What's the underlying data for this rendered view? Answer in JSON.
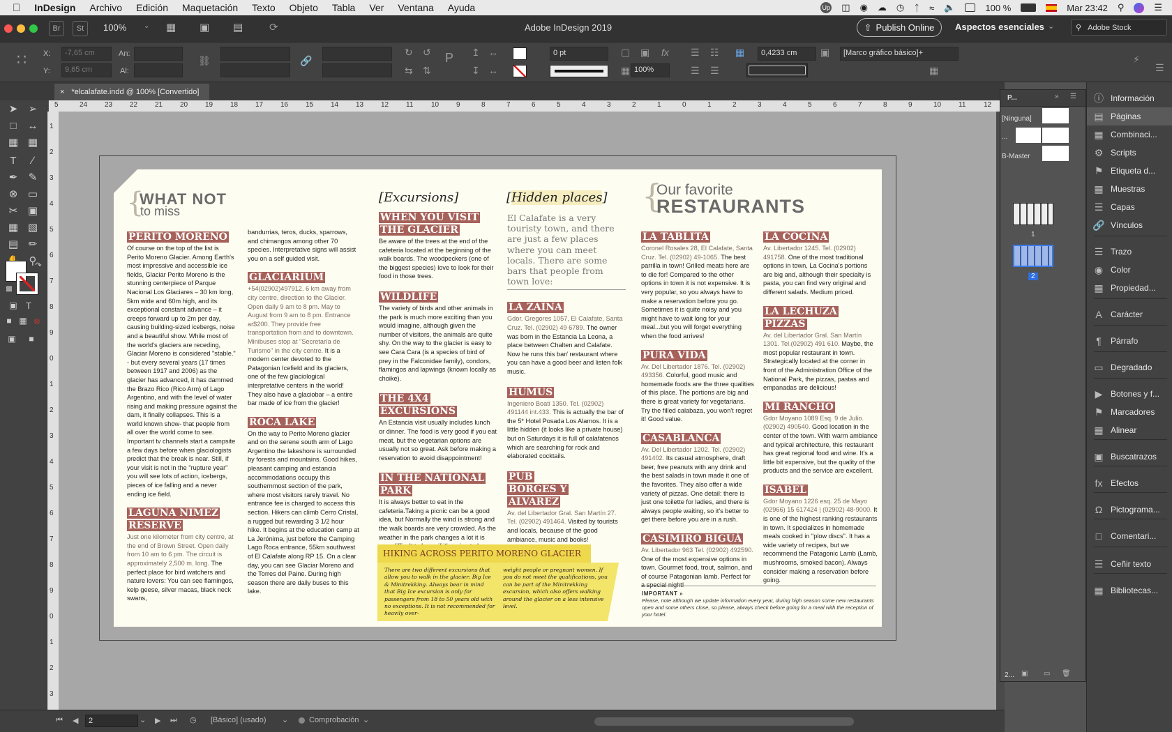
{
  "menubar": {
    "app": "InDesign",
    "items": [
      "Archivo",
      "Edición",
      "Maquetación",
      "Texto",
      "Objeto",
      "Tabla",
      "Ver",
      "Ventana",
      "Ayuda"
    ],
    "battery": "100 %",
    "clock": "Mar 23:42"
  },
  "appbar": {
    "title": "Adobe InDesign 2019",
    "br": "Br",
    "st": "St",
    "zoom": "100%",
    "publish": "Publish Online",
    "workspace": "Aspectos esenciales",
    "stock": "Adobe Stock"
  },
  "control": {
    "x_label": "X:",
    "x_value": "-7,65 cm",
    "y_label": "Y:",
    "y_value": "9,65 cm",
    "an_label": "An:",
    "al_label": "Al:",
    "stroke_weight": "0 pt",
    "scale": "100%",
    "offset": "0,4233 cm",
    "object_style": "[Marco gráfico básico]+"
  },
  "doc_tab": "*elcalafate.indd @ 100% [Convertido]",
  "ruler": {
    "h_ticks": [
      "5",
      "24",
      "23",
      "22",
      "21",
      "20",
      "19",
      "18",
      "17",
      "16",
      "15",
      "14",
      "13",
      "12",
      "11",
      "10",
      "9",
      "8",
      "7",
      "6",
      "5",
      "4",
      "3",
      "2",
      "1",
      "0",
      "1",
      "2",
      "3",
      "4",
      "5",
      "6",
      "7",
      "8",
      "9",
      "10",
      "11",
      "12",
      "13"
    ],
    "v_ticks": [
      "1",
      "2",
      "3",
      "4",
      "5",
      "6",
      "7",
      "8",
      "9",
      "0",
      "1",
      "2",
      "3",
      "4",
      "5",
      "6",
      "7",
      "8",
      "9",
      "0",
      "1",
      "2",
      "3"
    ]
  },
  "page": {
    "what_not_1": "WHAT NOT",
    "what_not_2": "to miss",
    "excursions": "Excursions",
    "hidden": "Hidden places",
    "fav_1": "Our favorite",
    "fav_2": "RESTAURANTS",
    "c1_h1": "PERITO MORENO",
    "c1_t1": "Of course on the top of the list is Perito Moreno Glacier. Among Earth's most impressive and accessible ice fields, Glaciar Perito Moreno is the stunning centerpiece of Parque Nacional Los Glaciares – 30 km long, 5km wide and 60m high, and its exceptional constant advance – it creeps forward up to 2m per day, causing building-sized icebergs, noise and a beautiful show. While most of the world's glaciers are receding, Glaciar Moreno is considered \"stable.\" - but every several years (17 times between 1917 and 2006) as the glacier has advanced, it has dammed the Brazo Rico (Rico Arm) of Lago Argentino, and with the level of water rising and making pressure against the dam, it finally collapses. This is a world known show- that people from all over the world come to see. Important tv channels start a campsite a few days before when glaciologists predict that the break is near. Still, if your visit is not in the \"rupture year\" you will see lots of action, icebergs, pieces of ice falling and a never ending ice field.",
    "c1_h2": "LAGUNA NIMEZ RESERVE",
    "c1_a2": "Just one kilometer from city centre, at the end of Brown Street. Open daily from 10 am to 6 pm. The circuit is approximately 2,500 m. long.",
    "c1_t2": "The perfect place for bird watchers and nature lovers: You can see flamingos, kelp geese, silver macas, black neck swans,",
    "c2_t0": "bandurrias, teros, ducks, sparrows, and chimangos among other 70 species. Interpretative signs will assist you on a self guided visit.",
    "c2_h1": "GLACIARIUM",
    "c2_a1": "+54(02902)497912. 6 km away from city centre, direction to the Glacier. Open daily 9 am to 8 pm. May to August from 9 am to 8 pm. Entrance ar$200. They provide free transportation from and to downtown. Minibuses stop at \"Secretaría de Turismo\" in the city centre.",
    "c2_t1": "It is a modern center devoted to the Patagonian Icefield and its glaciers, one of the few glaciological interpretative centers in the world! They also have a glaciobar – a entire bar made of ice from the glacier!",
    "c2_h2": "ROCA LAKE",
    "c2_t2": "On the way to Perito Moreno glacier and on the serene south arm of Lago Argentino the lakeshore is surrounded by forests and mountains. Good hikes, pleasant camping and estancia accommodations occupy this southernmost section of the park, where most visitors rarely travel. No entrance fee is charged to access this section. Hikers can climb Cerro Cristal, a rugged but rewarding 3 1/2 hour hike. It begins at the education camp at La Jerónima, just before the Camping Lago Roca entrance, 55km southwest of El Calafate along RP 15. On a clear day, you can see Glaciar Moreno and the Torres del Paine. During high season there are daily buses to this lake.",
    "c3_h1": "WHEN YOU VISIT THE GLACIER",
    "c3_t1": "Be aware of the trees at the end of the cafeteria located at the beginning of the walk boards. The woodpeckers (one of the biggest species) love to look for their food in those trees.",
    "c3_h2": "WILDLIFE",
    "c3_t2": "The variety of birds and other animals in the park is much more exciting than you would imagine, although given the number of visitors, the animals are quite shy. On the way to the glacier is easy to see Cara Cara (is a species of bird of prey in the Falconidae family), condors, flamingos and lapwings (known locally as choike).",
    "c3_h3": "THE 4X4 EXCURSIONS",
    "c3_t3": "An Estancia visit usually includes lunch or dinner. The food is very good if you eat meat, but the vegetarian options are usually not so great. Ask before making a reservation to avoid disappointment!",
    "c3_h4": "IN THE NATIONAL PARK",
    "c3_t4": "It is always better to eat in the cafeteria.Taking a picnic can be a good idea, but Normally the wind is strong and the walk boards are very crowded. As the weather in the park changes a lot it is very difficult to know if it's going to be a rainy day.",
    "hike_title": "HIKING ACROSS PERITO MORENO GLACIER",
    "hike_left": "There are two different excursions that allow you to walk in the glacier: Big Ice & Minitrekking. Always bear in mind that Big Ice excursion is only for passengers from 18 to 50 years old with no exceptions. It is not recommended for heavily over-",
    "hike_right": "weight people or pregnant women. If you do not meet the qualifications, you can be part of the Minitrekking excursion, which also offers walking around the glacier on a less intensive level.",
    "c4_intro": "El Calafate is a very touristy town, and there are just a few places where you can meet locals. There are some bars that people from town love:",
    "c4_h1": "LA ZAINA",
    "c4_a1": "Gdor. Gregores 1057, El Calafate, Santa Cruz. Tel. (02902) 49 6789.",
    "c4_t1": "The owner was born in the Estancia La Leona, a place between Chalten and Calafate. Now he runs this bar/ restaurant where you can have a good beer and listen folk music.",
    "c4_h2": "HUMUS",
    "c4_a2": "Ingeniero Boati 1350. Tel. (02902) 491144 int.433.",
    "c4_t2": "This is actually the bar of the 5* Hotel Posada Los Alamos. It is a little hidden (it looks like a private house) but on Saturdays it is full of calafatenos which are searching for rock and elaborated cocktails.",
    "c4_h3": "PUB BORGES Y ALVAREZ",
    "c4_a3": "Av. del Libertador Gral. San Martín 27. Tel. (02902) 491464.",
    "c4_t3": "Visited by tourists and locals, because of the good ambiance, music and books!",
    "c5_h1": "LA TABLITA",
    "c5_a1": "Coronel Rosales 28, El Calafate, Santa Cruz. Tel. (02902) 49-1065.",
    "c5_t1": "The best parrilla in town! Grilled meats here are to die for! Compared to the other options in town it is not expensive. It is very popular, so you always have to make a reservation before you go. Sometimes it is quite noisy and you might have to wait long for your meal...but you will forget everything when the food arrives!",
    "c5_h2": "PURA VIDA",
    "c5_a2": "Av. Del Libertador 1876. Tel. (02902) 493356.",
    "c5_t2": "Colorful, good music and homemade foods are the three qualities of this place. The portions are big and there is great variety for vegetarians. Try the filled calabaza, you won't regret it! Good value.",
    "c5_h3": "CASABLANCA",
    "c5_a3": "Av. Del Libertador 1202. Tel. (02902) 491402.",
    "c5_t3": "Its casual atmosphere, draft beer, free peanuts with any drink and the best salads in town made it one of the favorites. They also offer a wide variety of pizzas. One detail: there is just one toilette for ladies, and there is always people waiting, so it's better to get there before you are in a rush.",
    "c5_h4": "CASIMIRO BIGUÁ",
    "c5_a4": "Av. Libertador 963 Tel. (02902) 492590.",
    "c5_t4": "One of the most expensive options in town. Gourmet food, trout, salmon, and of course Patagonian lamb. Perfect for a special night!",
    "c6_h1": "LA COCINA",
    "c6_a1": "Av. Libertador 1245. Tel. (02902) 491758.",
    "c6_t1": "One of the most traditional options in town, La Cocina's portions are big and, although their specialty is pasta, you can find very original and different salads. Medium priced.",
    "c6_h2": "LA LECHUZA PIZZAS",
    "c6_a2": "Av. del Libertador Gral. San Martín 1301. Tel.(02902) 491 610.",
    "c6_t2": "Maybe, the most popular restaurant in town. Strategically located at the corner in front of the Administration Office of the National Park, the pizzas, pastas and empanadas are delicious!",
    "c6_h3": "MI RANCHO",
    "c6_a3": "Gdor Moyano 1089 Esq. 9 de Julio. (02902) 490540.",
    "c6_t3": "Good location in the center of the town. With warm ambiance and typical architecture, this restaurant has great regional food and wine. It's a little bit expensive, but the quality of the products and the service are excellent.",
    "c6_h4": "ISABEL",
    "c6_a4": "Gdor Moyano 1226 esq. 25 de Mayo (02966) 15 617424 | (02902) 48-9000.",
    "c6_t4": "It is one of the highest ranking restaurants in town. It specializes in homemade meals cooked in \"plow discs\". It has a wide variety of recipes, but we recommend the Patagonic Lamb (Lamb, mushrooms, smoked bacon). Always consider making a reservation before going.",
    "important_title": "IMPORTANT »",
    "important_text": "Please, note although we update information every year, during high season some new restaurants open and some others close, so please, always check before going for a meal with the reception of your hotel."
  },
  "pages_panel": {
    "title": "P...",
    "none": "[Ninguna]",
    "dots": "...",
    "b_master": "B-Master",
    "page1": "1",
    "page2": "2",
    "footer": "2..."
  },
  "dock": [
    "Información",
    "Páginas",
    "Combinaci...",
    "Scripts",
    "Etiqueta d...",
    "Muestras",
    "Capas",
    "Vínculos",
    "Trazo",
    "Color",
    "Propiedad...",
    "Carácter",
    "Párrafo",
    "Degradado",
    "Botones y f...",
    "Marcadores",
    "Alinear",
    "Buscatrazos",
    "Efectos",
    "Pictograma...",
    "Comentari...",
    "Ceñir texto",
    "Bibliotecas..."
  ],
  "status": {
    "page": "2",
    "style": "[Básico] (usado)",
    "preflight": "Comprobación"
  },
  "colors": {
    "heading_bg": "#a6625a",
    "hike_yellow": "#f3e46a",
    "page_bg": "#fefdf1"
  }
}
